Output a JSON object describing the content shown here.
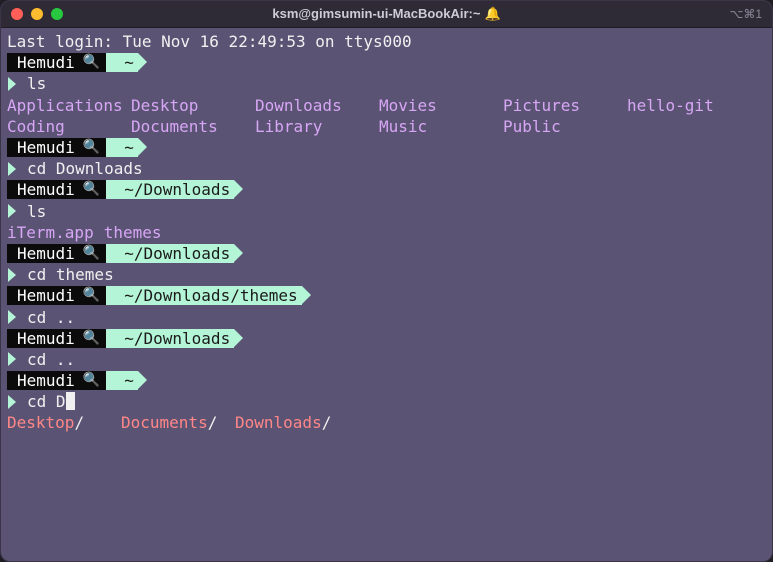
{
  "window": {
    "title": "ksm@gimsumin-ui-MacBookAir:~",
    "title_icon": "🔔",
    "shortcut": "⌥⌘1"
  },
  "terminal": {
    "login": "Last login: Tue Nov 16 22:49:53 on ttys000",
    "prompt_user": "Hemudi",
    "prompt_icon": "🔍",
    "blocks": [
      {
        "path": "~",
        "command": "ls"
      },
      {
        "path": "~",
        "command": "cd Downloads"
      },
      {
        "path": "~/Downloads",
        "command": "ls"
      },
      {
        "path": "~/Downloads",
        "command": "cd themes"
      },
      {
        "path": "~/Downloads/themes",
        "command": "cd .."
      },
      {
        "path": "~/Downloads",
        "command": "cd .."
      },
      {
        "path": "~",
        "command": "cd D"
      }
    ],
    "ls_home": [
      [
        "Applications",
        "Desktop",
        "Downloads",
        "Movies",
        "Pictures",
        "hello-git"
      ],
      [
        "Coding",
        "Documents",
        "Library",
        "Music",
        "Public"
      ]
    ],
    "ls_downloads": [
      "iTerm.app",
      "themes"
    ],
    "completions": [
      "Desktop",
      "Documents",
      "Downloads"
    ]
  },
  "colors": {
    "background": "#5b5374",
    "prompt_path": "#b4f5d7",
    "directory": "#d7a6f5",
    "completion": "#ff8787"
  }
}
